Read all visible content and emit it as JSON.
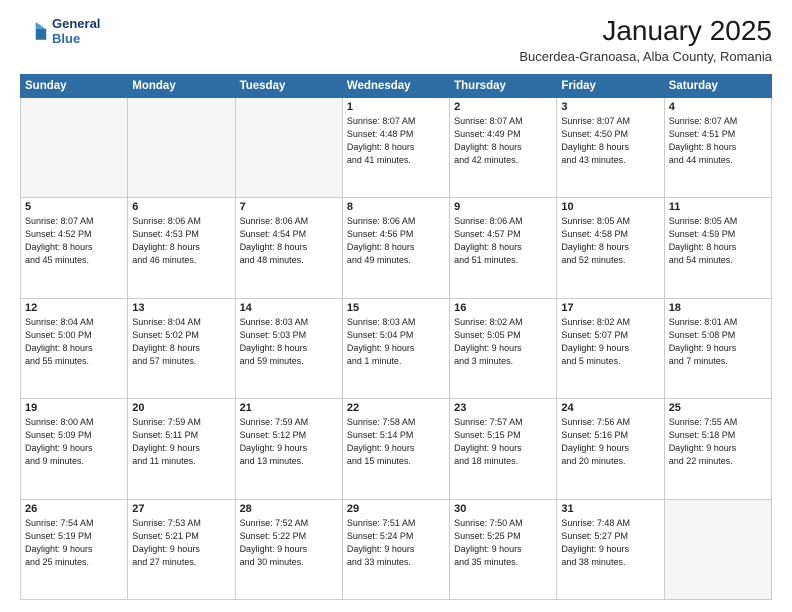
{
  "logo": {
    "line1": "General",
    "line2": "Blue"
  },
  "title": "January 2025",
  "subtitle": "Bucerdea-Granoasa, Alba County, Romania",
  "header_days": [
    "Sunday",
    "Monday",
    "Tuesday",
    "Wednesday",
    "Thursday",
    "Friday",
    "Saturday"
  ],
  "weeks": [
    [
      {
        "day": "",
        "info": ""
      },
      {
        "day": "",
        "info": ""
      },
      {
        "day": "",
        "info": ""
      },
      {
        "day": "1",
        "info": "Sunrise: 8:07 AM\nSunset: 4:48 PM\nDaylight: 8 hours\nand 41 minutes."
      },
      {
        "day": "2",
        "info": "Sunrise: 8:07 AM\nSunset: 4:49 PM\nDaylight: 8 hours\nand 42 minutes."
      },
      {
        "day": "3",
        "info": "Sunrise: 8:07 AM\nSunset: 4:50 PM\nDaylight: 8 hours\nand 43 minutes."
      },
      {
        "day": "4",
        "info": "Sunrise: 8:07 AM\nSunset: 4:51 PM\nDaylight: 8 hours\nand 44 minutes."
      }
    ],
    [
      {
        "day": "5",
        "info": "Sunrise: 8:07 AM\nSunset: 4:52 PM\nDaylight: 8 hours\nand 45 minutes."
      },
      {
        "day": "6",
        "info": "Sunrise: 8:06 AM\nSunset: 4:53 PM\nDaylight: 8 hours\nand 46 minutes."
      },
      {
        "day": "7",
        "info": "Sunrise: 8:06 AM\nSunset: 4:54 PM\nDaylight: 8 hours\nand 48 minutes."
      },
      {
        "day": "8",
        "info": "Sunrise: 8:06 AM\nSunset: 4:56 PM\nDaylight: 8 hours\nand 49 minutes."
      },
      {
        "day": "9",
        "info": "Sunrise: 8:06 AM\nSunset: 4:57 PM\nDaylight: 8 hours\nand 51 minutes."
      },
      {
        "day": "10",
        "info": "Sunrise: 8:05 AM\nSunset: 4:58 PM\nDaylight: 8 hours\nand 52 minutes."
      },
      {
        "day": "11",
        "info": "Sunrise: 8:05 AM\nSunset: 4:59 PM\nDaylight: 8 hours\nand 54 minutes."
      }
    ],
    [
      {
        "day": "12",
        "info": "Sunrise: 8:04 AM\nSunset: 5:00 PM\nDaylight: 8 hours\nand 55 minutes."
      },
      {
        "day": "13",
        "info": "Sunrise: 8:04 AM\nSunset: 5:02 PM\nDaylight: 8 hours\nand 57 minutes."
      },
      {
        "day": "14",
        "info": "Sunrise: 8:03 AM\nSunset: 5:03 PM\nDaylight: 8 hours\nand 59 minutes."
      },
      {
        "day": "15",
        "info": "Sunrise: 8:03 AM\nSunset: 5:04 PM\nDaylight: 9 hours\nand 1 minute."
      },
      {
        "day": "16",
        "info": "Sunrise: 8:02 AM\nSunset: 5:05 PM\nDaylight: 9 hours\nand 3 minutes."
      },
      {
        "day": "17",
        "info": "Sunrise: 8:02 AM\nSunset: 5:07 PM\nDaylight: 9 hours\nand 5 minutes."
      },
      {
        "day": "18",
        "info": "Sunrise: 8:01 AM\nSunset: 5:08 PM\nDaylight: 9 hours\nand 7 minutes."
      }
    ],
    [
      {
        "day": "19",
        "info": "Sunrise: 8:00 AM\nSunset: 5:09 PM\nDaylight: 9 hours\nand 9 minutes."
      },
      {
        "day": "20",
        "info": "Sunrise: 7:59 AM\nSunset: 5:11 PM\nDaylight: 9 hours\nand 11 minutes."
      },
      {
        "day": "21",
        "info": "Sunrise: 7:59 AM\nSunset: 5:12 PM\nDaylight: 9 hours\nand 13 minutes."
      },
      {
        "day": "22",
        "info": "Sunrise: 7:58 AM\nSunset: 5:14 PM\nDaylight: 9 hours\nand 15 minutes."
      },
      {
        "day": "23",
        "info": "Sunrise: 7:57 AM\nSunset: 5:15 PM\nDaylight: 9 hours\nand 18 minutes."
      },
      {
        "day": "24",
        "info": "Sunrise: 7:56 AM\nSunset: 5:16 PM\nDaylight: 9 hours\nand 20 minutes."
      },
      {
        "day": "25",
        "info": "Sunrise: 7:55 AM\nSunset: 5:18 PM\nDaylight: 9 hours\nand 22 minutes."
      }
    ],
    [
      {
        "day": "26",
        "info": "Sunrise: 7:54 AM\nSunset: 5:19 PM\nDaylight: 9 hours\nand 25 minutes."
      },
      {
        "day": "27",
        "info": "Sunrise: 7:53 AM\nSunset: 5:21 PM\nDaylight: 9 hours\nand 27 minutes."
      },
      {
        "day": "28",
        "info": "Sunrise: 7:52 AM\nSunset: 5:22 PM\nDaylight: 9 hours\nand 30 minutes."
      },
      {
        "day": "29",
        "info": "Sunrise: 7:51 AM\nSunset: 5:24 PM\nDaylight: 9 hours\nand 33 minutes."
      },
      {
        "day": "30",
        "info": "Sunrise: 7:50 AM\nSunset: 5:25 PM\nDaylight: 9 hours\nand 35 minutes."
      },
      {
        "day": "31",
        "info": "Sunrise: 7:48 AM\nSunset: 5:27 PM\nDaylight: 9 hours\nand 38 minutes."
      },
      {
        "day": "",
        "info": ""
      }
    ]
  ]
}
